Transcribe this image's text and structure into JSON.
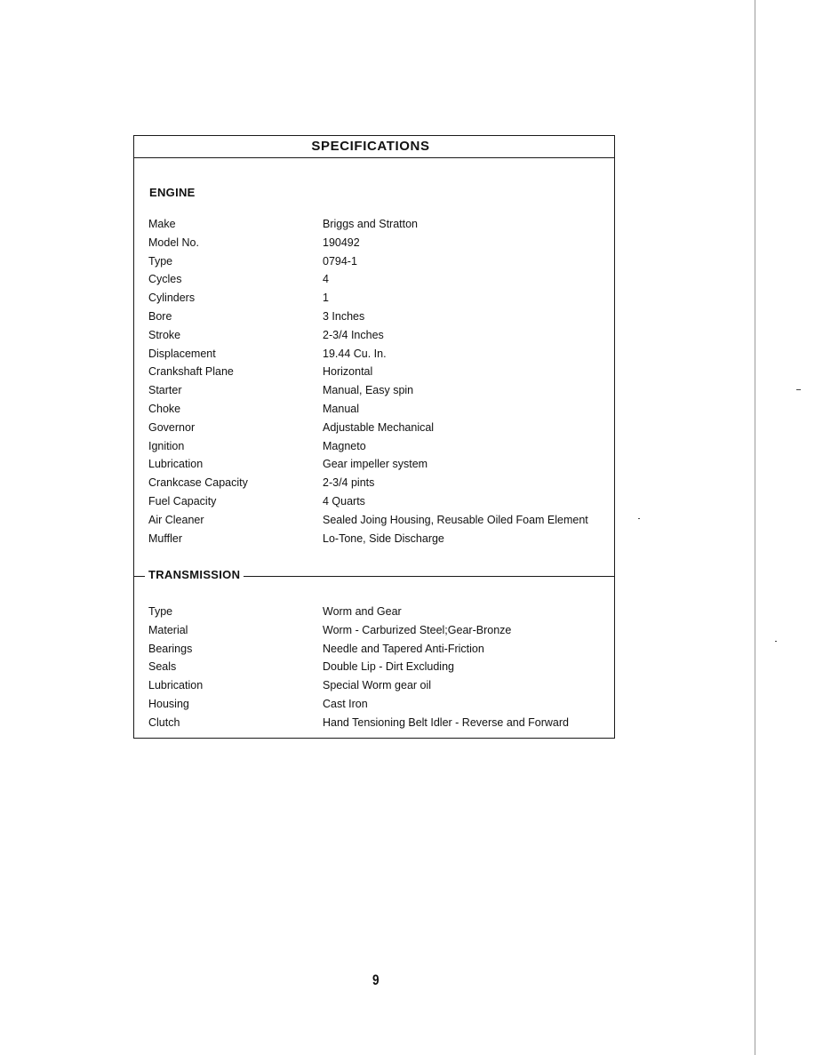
{
  "document": {
    "title": "SPECIFICATIONS",
    "page_number": "9",
    "sections": {
      "engine": {
        "heading": "ENGINE",
        "rows": [
          {
            "label": "Make",
            "value": "Briggs and Stratton"
          },
          {
            "label": "Model No.",
            "value": "190492"
          },
          {
            "label": "Type",
            "value": "0794-1"
          },
          {
            "label": "Cycles",
            "value": "4"
          },
          {
            "label": "Cylinders",
            "value": "1"
          },
          {
            "label": "Bore",
            "value": "3 Inches"
          },
          {
            "label": "Stroke",
            "value": "2-3/4 Inches"
          },
          {
            "label": "Displacement",
            "value": "19.44 Cu. In."
          },
          {
            "label": "Crankshaft Plane",
            "value": "Horizontal"
          },
          {
            "label": "Starter",
            "value": "Manual, Easy spin"
          },
          {
            "label": "Choke",
            "value": "Manual"
          },
          {
            "label": "Governor",
            "value": "Adjustable Mechanical"
          },
          {
            "label": "Ignition",
            "value": "Magneto"
          },
          {
            "label": "Lubrication",
            "value": "Gear impeller system"
          },
          {
            "label": "Crankcase Capacity",
            "value": "2-3/4 pints"
          },
          {
            "label": "Fuel Capacity",
            "value": "4 Quarts"
          },
          {
            "label": "Air Cleaner",
            "value": "Sealed Joing Housing, Reusable Oiled Foam Element"
          },
          {
            "label": "Muffler",
            "value": "Lo-Tone, Side Discharge"
          }
        ]
      },
      "transmission": {
        "heading": "TRANSMISSION",
        "rows": [
          {
            "label": "Type",
            "value": "Worm and Gear"
          },
          {
            "label": "Material",
            "value": "Worm - Carburized Steel;Gear-Bronze"
          },
          {
            "label": "Bearings",
            "value": "Needle and Tapered Anti-Friction"
          },
          {
            "label": "Seals",
            "value": "Double Lip - Dirt Excluding"
          },
          {
            "label": "Lubrication",
            "value": "Special Worm gear oil"
          },
          {
            "label": "Housing",
            "value": "Cast Iron"
          },
          {
            "label": "Clutch",
            "value": "Hand Tensioning Belt Idler - Reverse and Forward"
          }
        ]
      }
    }
  }
}
